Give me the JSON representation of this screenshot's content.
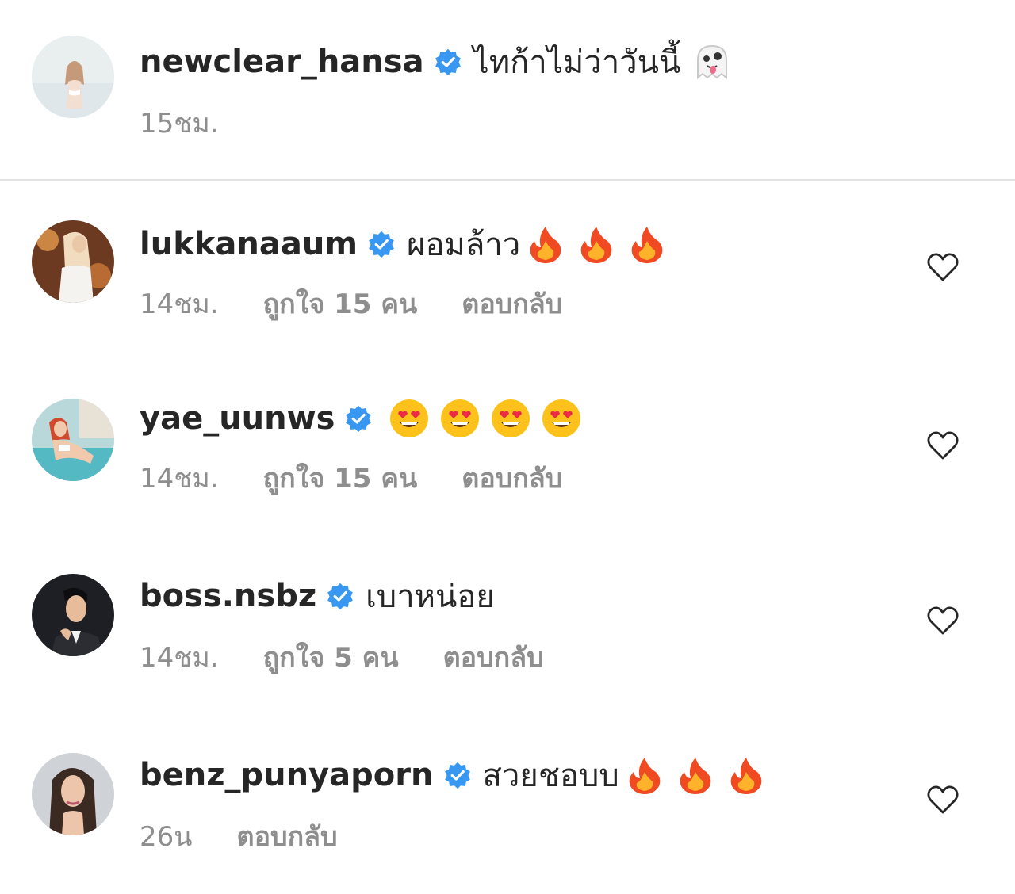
{
  "caption": {
    "username": "newclear_hansa",
    "text": "ไทก้าไม่ว่าวันนี้",
    "emoji": "ghost-emoji",
    "time": "15ชม."
  },
  "comments": [
    {
      "username": "lukkanaaum",
      "text": "ผอมล้าว",
      "emojis": [
        "fire-emoji",
        "fire-emoji",
        "fire-emoji"
      ],
      "time": "14ชม.",
      "likes": "ถูกใจ 15 คน",
      "reply": "ตอบกลับ"
    },
    {
      "username": "yae_uunws",
      "text": "",
      "emojis": [
        "heart-eyes-emoji",
        "heart-eyes-emoji",
        "heart-eyes-emoji",
        "heart-eyes-emoji"
      ],
      "time": "14ชม.",
      "likes": "ถูกใจ 15 คน",
      "reply": "ตอบกลับ"
    },
    {
      "username": "boss.nsbz",
      "text": "เบาหน่อย",
      "emojis": [],
      "time": "14ชม.",
      "likes": "ถูกใจ 5 คน",
      "reply": "ตอบกลับ"
    },
    {
      "username": "benz_punyaporn",
      "text": "สวยชอบบ",
      "emojis": [
        "fire-emoji",
        "fire-emoji",
        "fire-emoji"
      ],
      "time": "26น",
      "likes": "",
      "reply": "ตอบกลับ"
    }
  ],
  "colors": {
    "text_primary": "#262626",
    "text_secondary": "#8e8e8e",
    "verified_blue": "#3897f0",
    "divider": "#e2e2e2"
  },
  "icons": {
    "verified": "verified-badge-icon",
    "like": "heart-outline-icon"
  }
}
